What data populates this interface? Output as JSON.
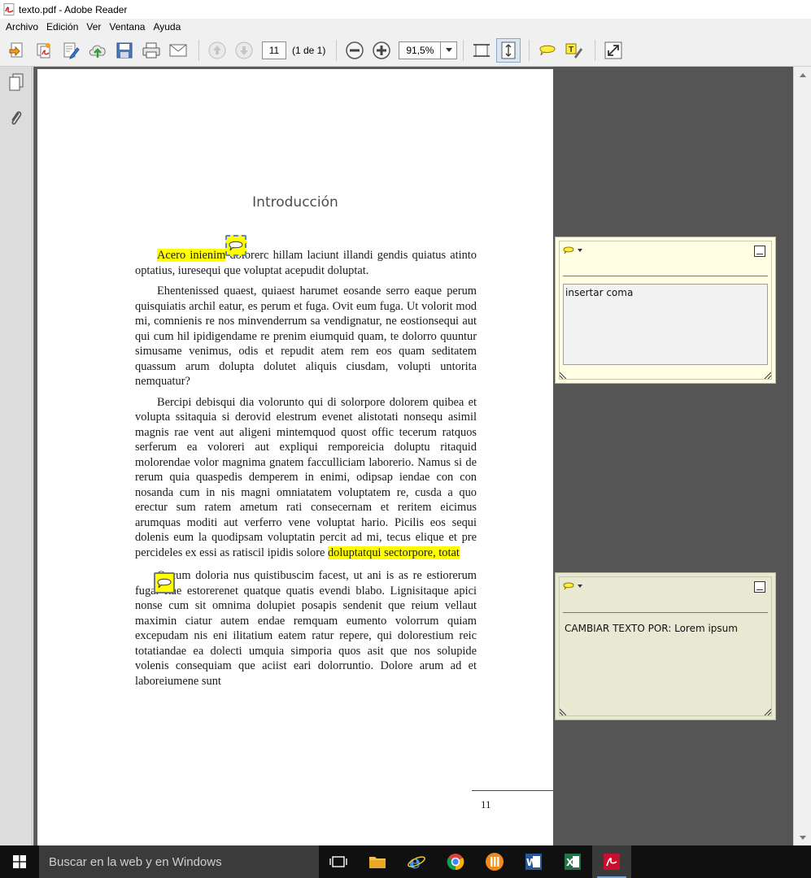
{
  "window": {
    "title": "texto.pdf - Adobe Reader"
  },
  "menu": {
    "items": [
      "Archivo",
      "Edición",
      "Ver",
      "Ventana",
      "Ayuda"
    ]
  },
  "toolbar": {
    "page_input": "11",
    "page_total": "(1 de 1)",
    "zoom_value": "91,5%"
  },
  "document": {
    "title": "Introducción",
    "paragraphs": {
      "p1_highlight": "Acero inienim",
      "p1_rest": " dolorerc hillam laciunt illandi gendis quiatus atinto optatius, iuresequi que voluptat acepudit doluptat.",
      "p2": "Ehentenissed quaest, quiaest harumet eosande serro eaque perum quisquiatis archil eatur, es perum et fuga. Ovit eum fuga. Ut volorit mod mi, comnienis re nos minvenderrum sa vendignatur, ne eostionsequi aut qui cum hil ipidigendame re prenim eiumquid quam, te dolorro quuntur simusame venimus, odis et repudit atem rem eos quam seditatem quassum arum dolupta dolutet aliquis ciusdam, volupti untorita nemquatur?",
      "p3_start": "Bercipi debisqui dia voloruntо qui di solorpore dolorem quibea et volupta ssitaquia si derovid elestrum evenet alistotati nonsequ asimil magnis rae vent aut aligeni mintemquod quost offic tecerum ratquos serferum ea voloreri aut expliqui remporeicia doluptu ritaquid molorendae volor magnima gnatem facculliciam laborerio. Namus si de rerum quia quaspedis demperem in enimi, odipsap iendae con con nosanda cum in nis magni omniatatem voluptatem re, cusda a quo erectur sum ratem ametum rati consecernam et reritem eicimus arumquas moditi aut verferro vene voluptat hario. Picilis eos sequi dolenis eum la quodipsam voluptatin percit ad mi, tecus elique et pre percideles ex essi as ratiscil ipidis solore ",
      "p3_highlight": "doluptatqui sectorpore, totat",
      "p4": "Occum doloria nus quistibuscim facest, ut ani is as re estiorerum fuga. Itae estorerenet quatque quatis evendi blabo. Lignisitaque apici nonse cum sit omnima dolupiet posapis sendenit que reium vellaut maximin ciatur autem endae remquam eumento volorrum quiam excepudam nis eni ilitatium eatem ratur repere, qui dolorestium reic totatiandae ea dolecti umquia simporia quos asit que nos solupide volenis consequiam que aciist eari dolorruntio. Dolore arum ad et laboreiumene sunt"
    },
    "page_number": "11"
  },
  "comments": [
    {
      "text": "insertar coma"
    },
    {
      "text": "CAMBIAR TEXTO POR: Lorem ipsum"
    }
  ],
  "taskbar": {
    "search_placeholder": "Buscar en la web y en Windows"
  },
  "colors": {
    "highlight": "#ffff00",
    "note_bg": "#fffde2",
    "doc_bg": "#5c5c5c"
  }
}
